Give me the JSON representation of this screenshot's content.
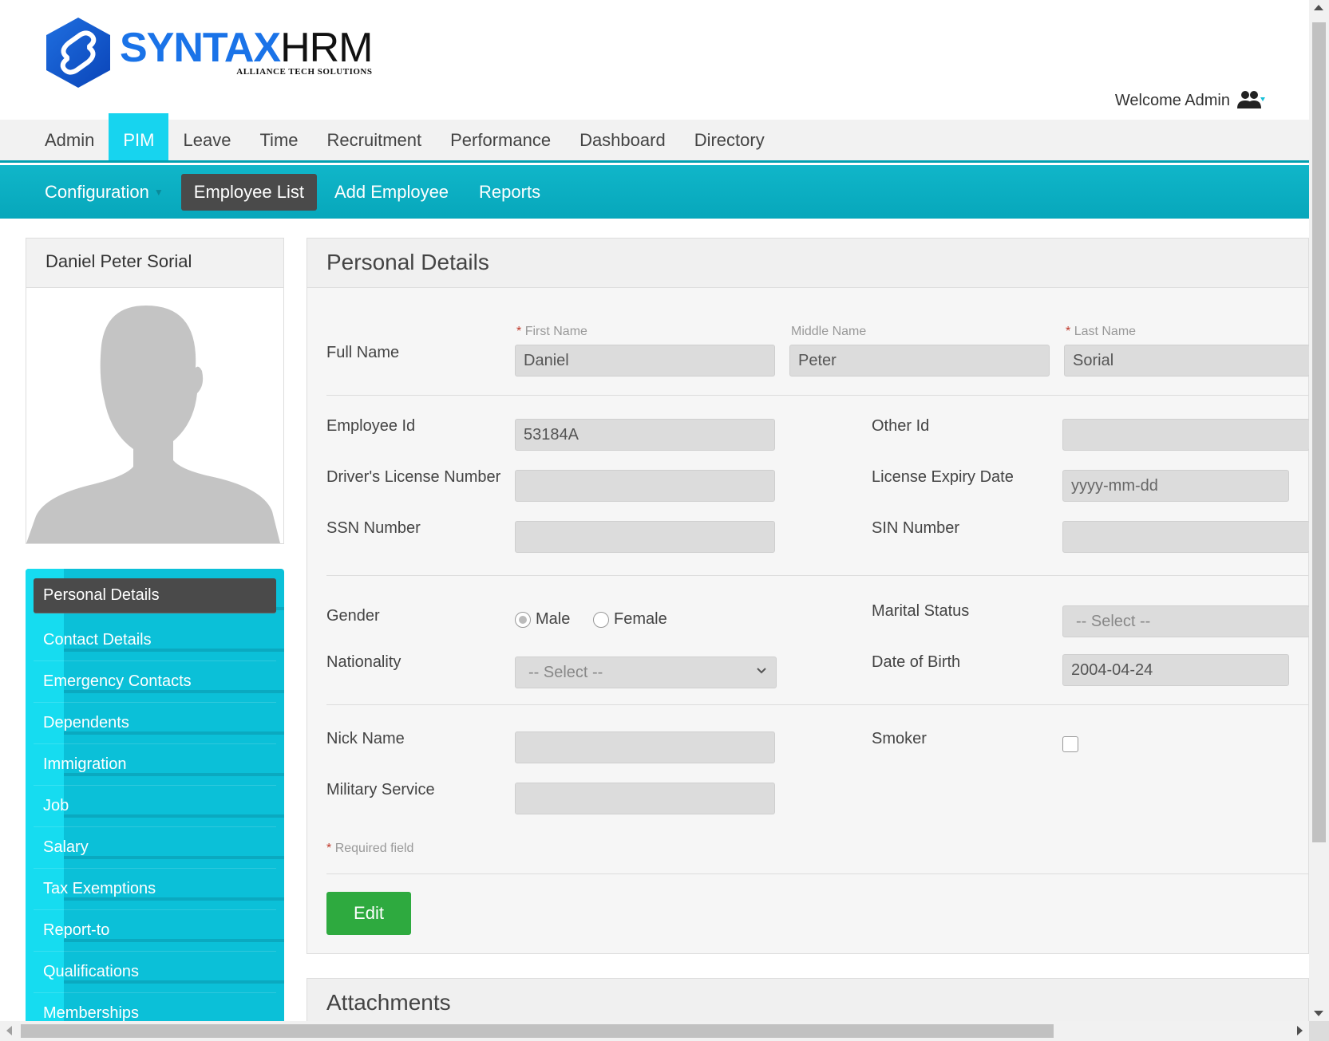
{
  "logo": {
    "brand_a": "SYNTAX",
    "brand_b": "HRM",
    "tagline": "ALLIANCE TECH SOLUTIONS"
  },
  "header": {
    "welcome": "Welcome Admin",
    "user_icon": "users-icon"
  },
  "main_nav": [
    "Admin",
    "PIM",
    "Leave",
    "Time",
    "Recruitment",
    "Performance",
    "Dashboard",
    "Directory"
  ],
  "main_nav_active": "PIM",
  "sub_nav": {
    "configuration": "Configuration",
    "employee_list": "Employee List",
    "add_employee": "Add Employee",
    "reports": "Reports"
  },
  "profile": {
    "name": "Daniel Peter Sorial",
    "photo_icon": "avatar-silhouette-icon"
  },
  "side_menu": [
    "Personal Details",
    "Contact Details",
    "Emergency Contacts",
    "Dependents",
    "Immigration",
    "Job",
    "Salary",
    "Tax Exemptions",
    "Report-to",
    "Qualifications",
    "Memberships"
  ],
  "side_menu_active": "Personal Details",
  "form": {
    "title": "Personal Details",
    "full_name_label": "Full Name",
    "first_name_label": "First Name",
    "middle_name_label": "Middle Name",
    "last_name_label": "Last Name",
    "first_name": "Daniel",
    "middle_name": "Peter",
    "last_name": "Sorial",
    "employee_id_label": "Employee Id",
    "employee_id": "53184A",
    "other_id_label": "Other Id",
    "other_id": "",
    "drivers_license_label": "Driver's License Number",
    "drivers_license": "",
    "license_expiry_label": "License Expiry Date",
    "license_expiry_placeholder": "yyyy-mm-dd",
    "ssn_label": "SSN Number",
    "ssn": "",
    "sin_label": "SIN Number",
    "sin": "",
    "gender_label": "Gender",
    "gender_male": "Male",
    "gender_female": "Female",
    "gender_selected": "Male",
    "marital_status_label": "Marital Status",
    "marital_status": "-- Select --",
    "nationality_label": "Nationality",
    "nationality": "-- Select --",
    "dob_label": "Date of Birth",
    "dob": "2004-04-24",
    "nick_name_label": "Nick Name",
    "nick_name": "",
    "smoker_label": "Smoker",
    "smoker": false,
    "military_label": "Military Service",
    "military": "",
    "required_asterisk": "*",
    "required_note": "Required field",
    "edit_button": "Edit"
  },
  "attachments": {
    "title": "Attachments"
  },
  "colors": {
    "accent": "#17d4ef",
    "subnav": "#07a7bb",
    "active_dark": "#4a4a4a",
    "edit_green": "#2eaa3f",
    "brand_blue": "#1a73e8"
  }
}
